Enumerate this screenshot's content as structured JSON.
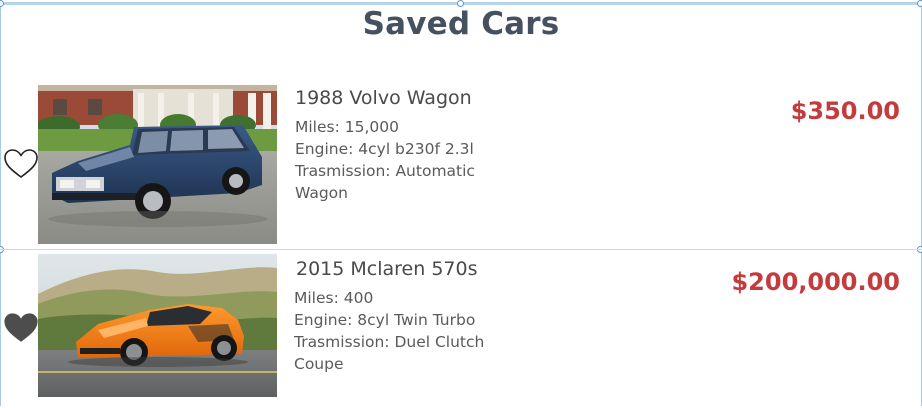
{
  "page": {
    "title": "Saved Cars"
  },
  "cars": [
    {
      "name": "1988 Volvo Wagon",
      "miles": "Miles: 15,000",
      "engine": "Engine: 4cyl b230f 2.3l",
      "transmission": "Trasmission: Automatic",
      "body": "Wagon",
      "price": "$350.00",
      "saved": false,
      "car_color": "#2c4468"
    },
    {
      "name": "2015 Mclaren 570s",
      "miles": "Miles: 400",
      "engine": "Engine: 8cyl Twin Turbo",
      "transmission": "Trasmission: Duel Clutch",
      "body": "Coupe",
      "price": "$200,000.00",
      "saved": true,
      "car_color": "#f07d12"
    }
  ],
  "colors": {
    "price": "#c53b3d",
    "title": "#465160",
    "heart_filled": "#4d4d4d"
  },
  "icons": {
    "save": "heart-icon"
  }
}
